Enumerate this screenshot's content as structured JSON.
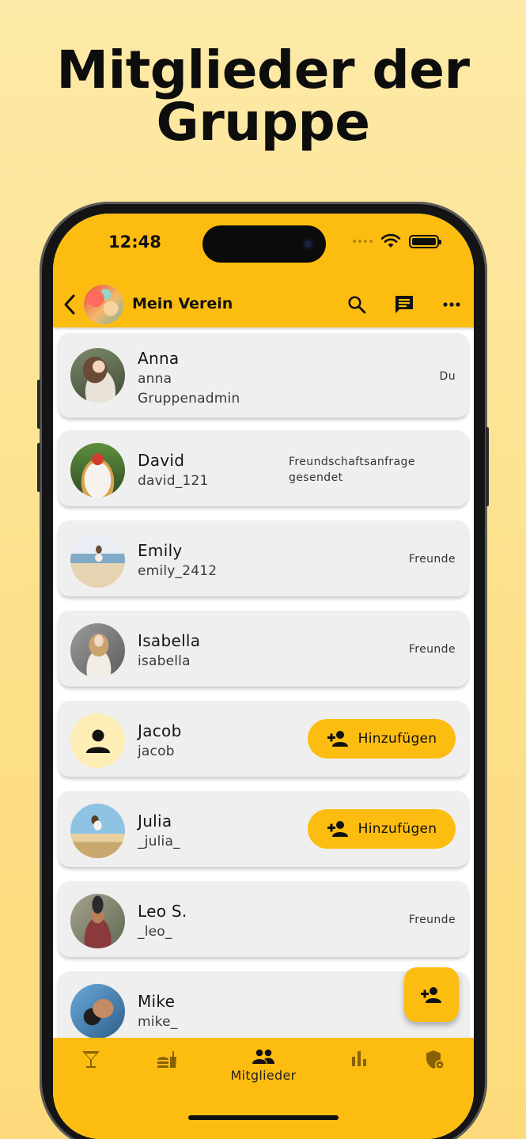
{
  "headline": {
    "line1": "Mitglieder der",
    "line2": "Gruppe"
  },
  "status_bar": {
    "time": "12:48"
  },
  "app_bar": {
    "group_name": "Mein Verein",
    "icons": [
      "back-arrow-icon",
      "search-icon",
      "chat-icon",
      "more-horizontal-icon"
    ]
  },
  "members": [
    {
      "name": "Anna",
      "username": "anna",
      "role": "Gruppenadmin",
      "status": "Du"
    },
    {
      "name": "David",
      "username": "david_121",
      "status": "Freundschaftsanfrage gesendet"
    },
    {
      "name": "Emily",
      "username": "emily_2412",
      "status": "Freunde"
    },
    {
      "name": "Isabella",
      "username": "isabella",
      "status": "Freunde"
    },
    {
      "name": "Jacob",
      "username": "jacob",
      "action": "Hinzufügen"
    },
    {
      "name": "Julia",
      "username": "_julia_",
      "action": "Hinzufügen"
    },
    {
      "name": "Leo S.",
      "username": "_leo_",
      "status": "Freunde"
    },
    {
      "name": "Mike",
      "username": "mike_"
    }
  ],
  "bottom_nav": {
    "items": [
      {
        "icon": "cocktail-icon"
      },
      {
        "icon": "food-icon"
      },
      {
        "icon": "group-icon",
        "label": "Mitglieder",
        "active": true
      },
      {
        "icon": "bar-chart-icon"
      },
      {
        "icon": "shield-lock-icon"
      }
    ]
  },
  "colors": {
    "accent": "#fdbd10",
    "card": "#efefef",
    "placeholder_avatar": "#fdeeb6"
  }
}
